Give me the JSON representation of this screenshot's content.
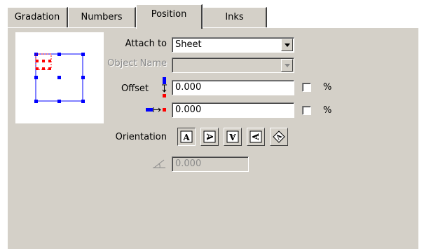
{
  "tabs": [
    {
      "label": "Gradation"
    },
    {
      "label": "Numbers"
    },
    {
      "label": "Position"
    },
    {
      "label": "Inks"
    }
  ],
  "position": {
    "attach_to_label": "Attach to",
    "attach_to_value": "Sheet",
    "object_name_label": "Object Name",
    "object_name_value": "",
    "offset_label": "Offset",
    "offset_vertical_value": "0.000",
    "offset_horizontal_value": "0.000",
    "percent_symbol": "%",
    "orientation_label": "Orientation",
    "angle_value": "0.000"
  },
  "colors": {
    "accent_blue": "#0000ff",
    "accent_red": "#ff0000"
  }
}
